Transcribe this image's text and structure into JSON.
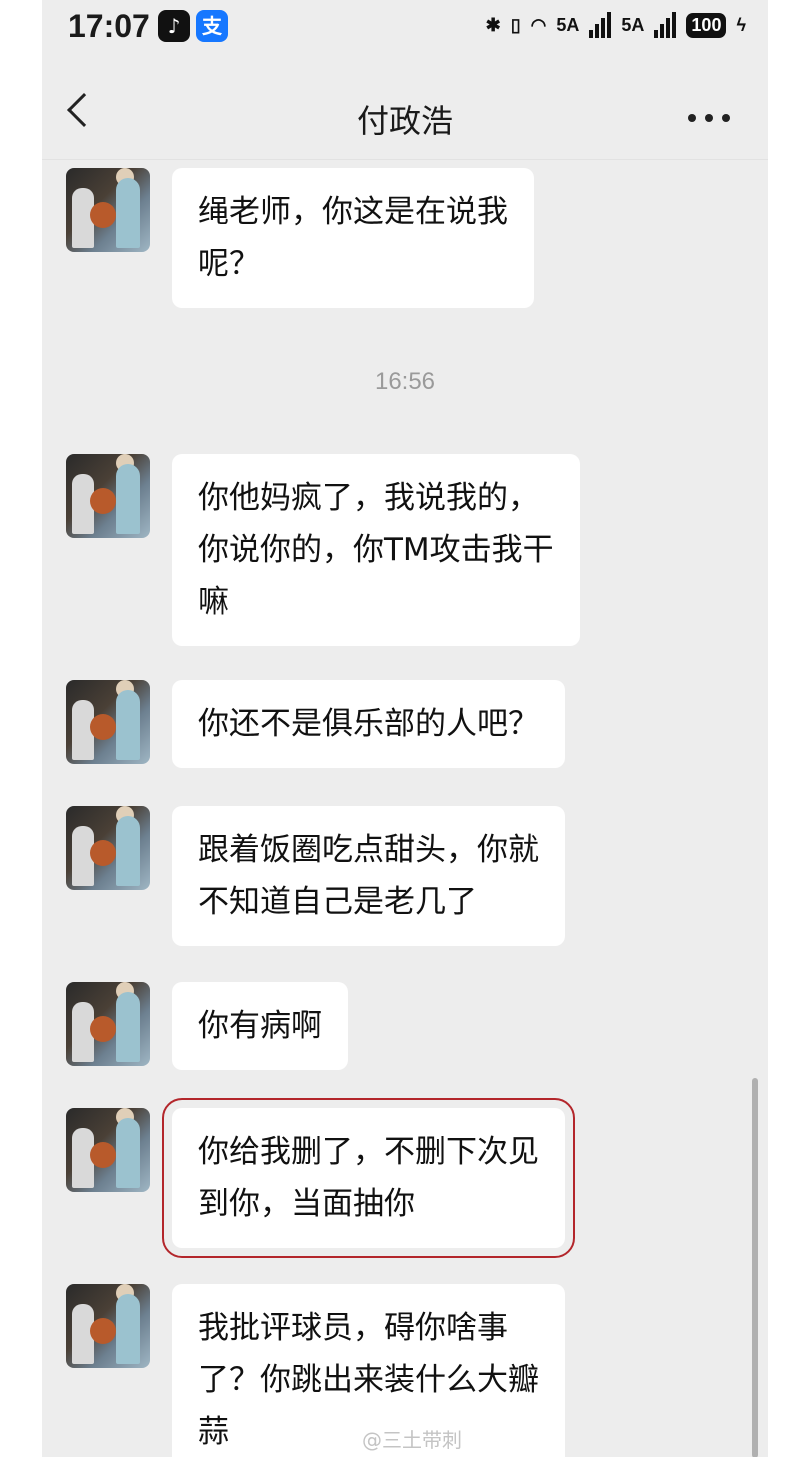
{
  "status_bar": {
    "time": "17:07",
    "apps": [
      "tiktok-icon",
      "alipay-icon"
    ],
    "alipay_glyph": "支",
    "signal_1_label": "5A",
    "signal_2_label": "5A",
    "battery": "100"
  },
  "header": {
    "title": "付政浩"
  },
  "messages": [
    {
      "text": "绳老师，你这是在说我呢？",
      "lines": [
        "绳老师，你这是在说我",
        "呢？"
      ]
    },
    {
      "timestamp": "16:56"
    },
    {
      "text": "你他妈疯了，我说我的，你说你的，你TM攻击我干嘛",
      "lines": [
        "你他妈疯了，我说我的，",
        "你说你的，你TM攻击我干",
        "嘛"
      ]
    },
    {
      "text": "你还不是俱乐部的人吧？",
      "lines": [
        "你还不是俱乐部的人吧？"
      ]
    },
    {
      "text": "跟着饭圈吃点甜头，你就不知道自己是老几了",
      "lines": [
        "跟着饭圈吃点甜头，你就",
        "不知道自己是老几了"
      ]
    },
    {
      "text": "你有病啊",
      "lines": [
        "你有病啊"
      ]
    },
    {
      "text": "你给我删了，不删下次见到你，当面抽你",
      "lines": [
        "你给我删了，不删下次见",
        "到你，当面抽你"
      ],
      "highlighted": true
    },
    {
      "text": "我批评球员，碍你啥事了？你跳出来装什么大瓣蒜",
      "lines": [
        "我批评球员，碍你啥事",
        "了？你跳出来装什么大瓣",
        "蒜"
      ]
    }
  ],
  "watermark": "@三土带刺",
  "colors": {
    "background": "#ededed",
    "bubble": "#ffffff",
    "highlight_border": "#b3262b"
  }
}
